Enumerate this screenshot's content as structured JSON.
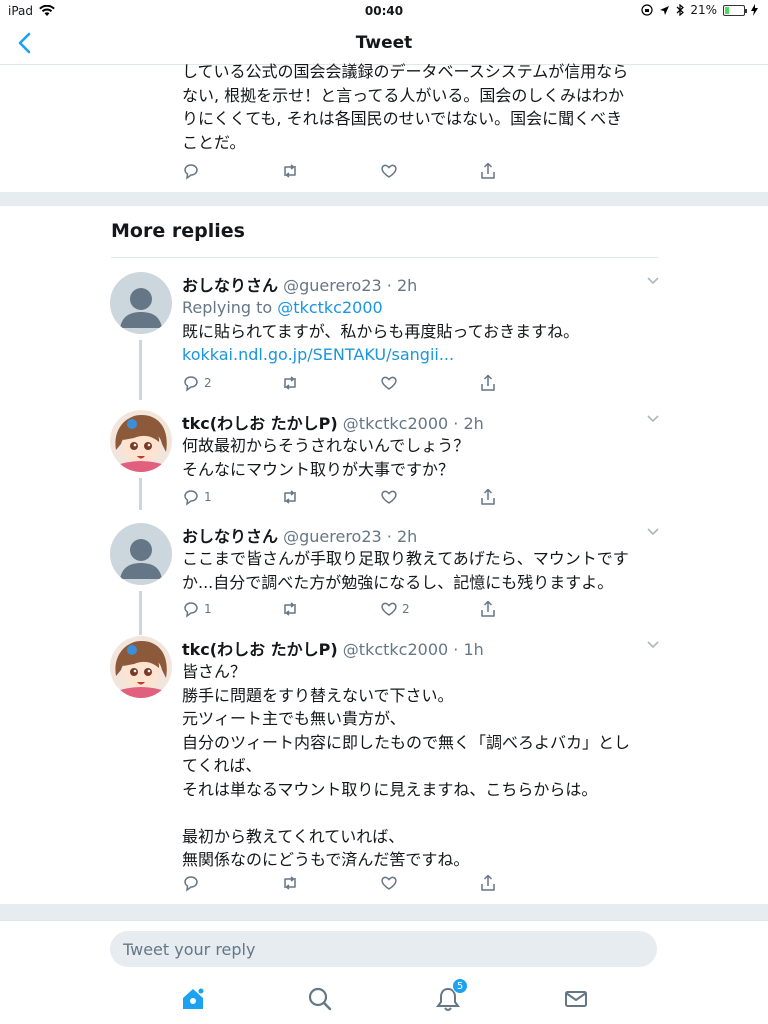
{
  "status": {
    "device": "iPad",
    "time": "00:40",
    "battery": "21%",
    "battery_level": 0.21
  },
  "nav": {
    "title": "Tweet"
  },
  "top_tweet": {
    "lines": [
      "している公式の国会会議録のデータベースシステムが信用なら",
      "ない, 根拠を示せ！と言ってる人がいる。国会のしくみはわか",
      "りにくくても, それは各国民のせいではない。国会に聞くべき",
      "ことだ。"
    ]
  },
  "more_replies": "More replies",
  "replies": [
    {
      "name": "おしなりさん",
      "handle": "@guerero23 · 2h",
      "replying_prefix": "Replying to ",
      "replying_to": "@tkctkc2000",
      "lines": [
        "既に貼られてますが、私からも再度貼っておきますね。"
      ],
      "link": "kokkai.ndl.go.jp/SENTAKU/sangii...",
      "reply_count": "2",
      "like_count": ""
    },
    {
      "name": "tkc(わしお たかしP)",
      "handle": "@tkctkc2000 · 2h",
      "lines": [
        "何故最初からそうされないんでしょう？",
        "そんなにマウント取りが大事ですか？"
      ],
      "reply_count": "1",
      "like_count": ""
    },
    {
      "name": "おしなりさん",
      "handle": "@guerero23 · 2h",
      "lines": [
        "ここまで皆さんが手取り足取り教えてあげたら、マウントです",
        "か...自分で調べた方が勉強になるし、記憶にも残りますよ。"
      ],
      "reply_count": "1",
      "like_count": "2"
    },
    {
      "name": "tkc(わしお たかしP)",
      "handle": "@tkctkc2000 · 1h",
      "lines": [
        "皆さん？",
        "勝手に問題をすり替えないで下さい。",
        "元ツィート主でも無い貴方が、",
        "自分のツィート内容に即したもので無く「調べろよバカ」とし",
        "てくれば、",
        "それは単なるマウント取りに見えますね、こちらからは。",
        "",
        "最初から教えてくれていれば、",
        "無関係なのにどうもで済んだ筈ですね。"
      ],
      "reply_count": "",
      "like_count": ""
    }
  ],
  "composer": {
    "placeholder": "Tweet your reply"
  },
  "tabs": {
    "notifications_badge": "5"
  },
  "colors": {
    "accent": "#1da1f2",
    "muted": "#657786",
    "separator": "#e6ecf0"
  }
}
